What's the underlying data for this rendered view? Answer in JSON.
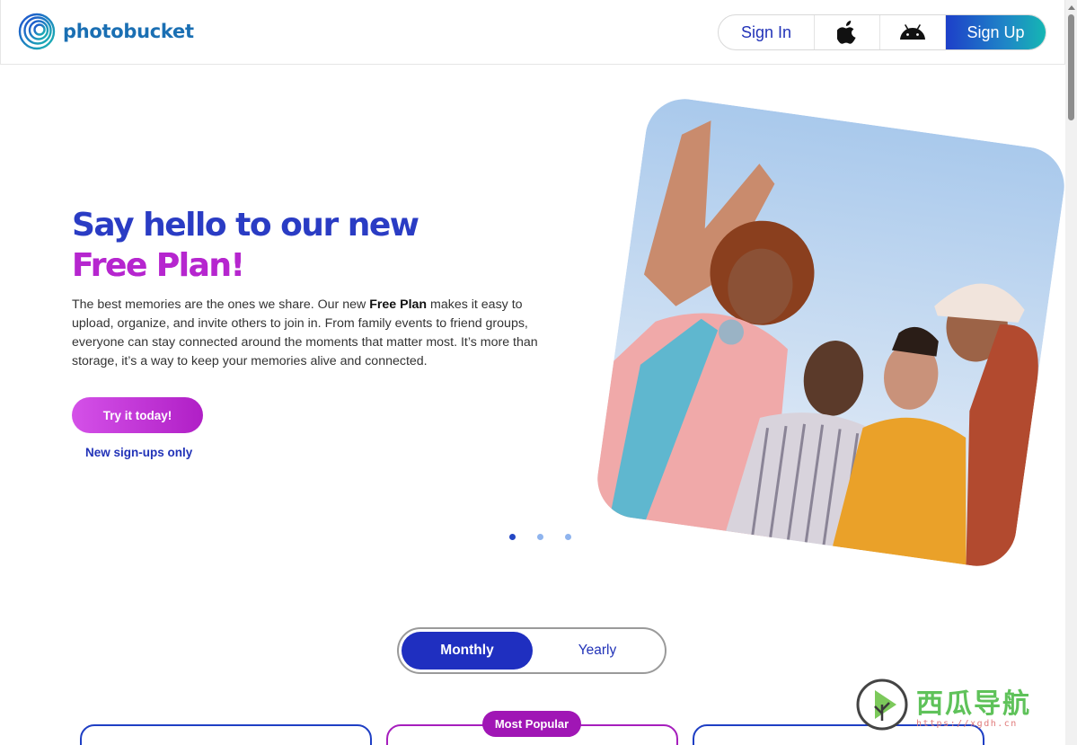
{
  "header": {
    "brand": "photobucket",
    "auth": {
      "sign_in": "Sign In",
      "sign_up": "Sign Up",
      "apple_icon": "apple-icon",
      "android_icon": "android-icon"
    }
  },
  "hero": {
    "title_part1": "Say hello to our new ",
    "title_part2": "Free Plan!",
    "desc_before": "The best memories are the ones we share. Our new ",
    "desc_bold": "Free Plan",
    "desc_after": " makes it easy to upload, organize, and invite others to join in. From family events to friend groups, everyone can stay connected around the moments that matter most. It’s more than storage, it’s a way to keep your memories alive and connected.",
    "cta": "Try it today!",
    "cta_note": "New sign-ups only",
    "carousel": {
      "slides": 3,
      "active": 1
    }
  },
  "billing": {
    "monthly": "Monthly",
    "yearly": "Yearly",
    "selected": "Monthly"
  },
  "plans": {
    "badge": "Most Popular"
  },
  "watermark": {
    "text": "西瓜导航",
    "url": "https://xgdh.cn"
  },
  "colors": {
    "brand_blue": "#2a3cc4",
    "brand_purple": "#b626cf",
    "toggle_active": "#1f2fc0",
    "badge": "#a016b5"
  }
}
